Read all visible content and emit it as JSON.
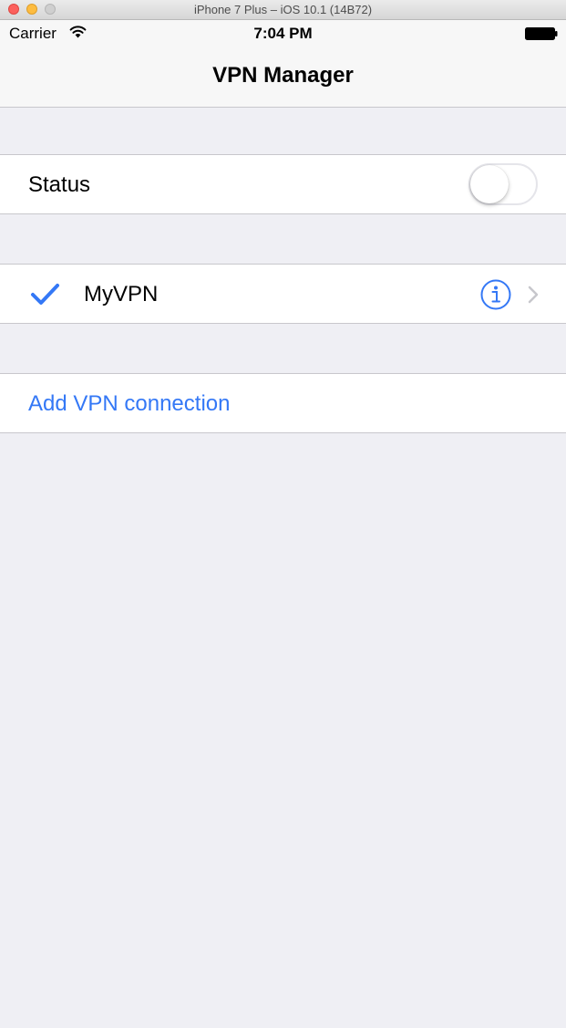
{
  "window": {
    "title": "iPhone 7 Plus – iOS 10.1 (14B72)"
  },
  "status_bar": {
    "carrier": "Carrier",
    "time": "7:04 PM"
  },
  "nav": {
    "title": "VPN Manager"
  },
  "status_row": {
    "label": "Status",
    "toggle_on": false
  },
  "vpn_row": {
    "name": "MyVPN",
    "selected": true
  },
  "add_row": {
    "label": "Add VPN connection"
  },
  "colors": {
    "tint": "#3478f6",
    "background": "#efeff4",
    "separator": "#c8c7cc"
  },
  "icons": {
    "wifi": "wifi-icon",
    "battery": "battery-icon",
    "checkmark": "checkmark-icon",
    "info": "info-icon",
    "chevron": "chevron-right-icon"
  }
}
